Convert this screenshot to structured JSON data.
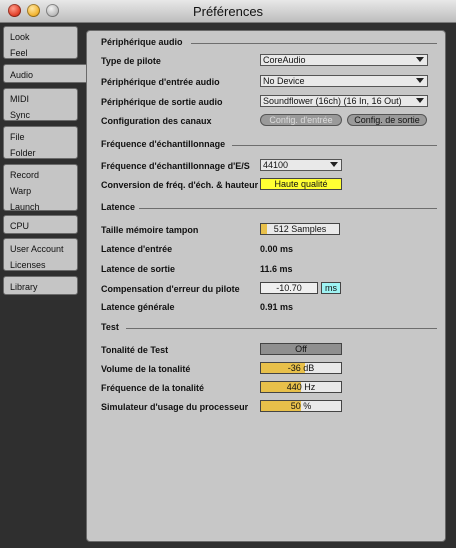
{
  "window": {
    "title": "Préférences"
  },
  "sidebar": {
    "items": [
      {
        "lines": [
          "Look",
          "Feel"
        ]
      },
      {
        "lines": [
          "Audio"
        ]
      },
      {
        "lines": [
          "MIDI",
          "Sync"
        ]
      },
      {
        "lines": [
          "File",
          "Folder"
        ]
      },
      {
        "lines": [
          "Record",
          "Warp",
          "Launch"
        ]
      },
      {
        "lines": [
          "CPU"
        ]
      },
      {
        "lines": [
          "User Account",
          "Licenses"
        ]
      },
      {
        "lines": [
          "Library"
        ]
      }
    ]
  },
  "audio_device": {
    "heading": "Périphérique audio",
    "driver_label": "Type de pilote",
    "driver_value": "CoreAudio",
    "input_label": "Périphérique d'entrée audio",
    "input_value": "No Device",
    "output_label": "Périphérique de sortie audio",
    "output_value": "Soundflower (16ch) (16 In, 16 Out)",
    "channels_label": "Configuration des canaux",
    "input_config_button": "Config. d'entrée",
    "output_config_button": "Config. de sortie"
  },
  "sample_rate": {
    "heading": "Fréquence d'échantillonnage",
    "rate_label": "Fréquence d'échantillonnage d'E/S",
    "rate_value": "44100",
    "conversion_label": "Conversion de fréq. d'éch. & hauteur",
    "conversion_value": "Haute qualité"
  },
  "latency": {
    "heading": "Latence",
    "buffer_label": "Taille mémoire tampon",
    "buffer_value": "512 Samples",
    "input_latency_label": "Latence d'entrée",
    "input_latency_value": "0.00 ms",
    "output_latency_label": "Latence de sortie",
    "output_latency_value": "11.6 ms",
    "compensation_label": "Compensation d'erreur du pilote",
    "compensation_value": "-10.70",
    "compensation_unit": "ms",
    "overall_label": "Latence générale",
    "overall_value": "0.91 ms"
  },
  "test": {
    "heading": "Test",
    "tone_label": "Tonalité de Test",
    "tone_value": "Off",
    "volume_label": "Volume de la tonalité",
    "volume_value": "-36 dB",
    "frequency_label": "Fréquence de la tonalité",
    "frequency_value": "440 Hz",
    "cpu_sim_label": "Simulateur d'usage du processeur",
    "cpu_sim_value": "50 %"
  },
  "colors": {
    "yellow_active": "#ffff33",
    "amber_fill": "#e8c04a",
    "cyan_unit": "#9ef3f3"
  }
}
